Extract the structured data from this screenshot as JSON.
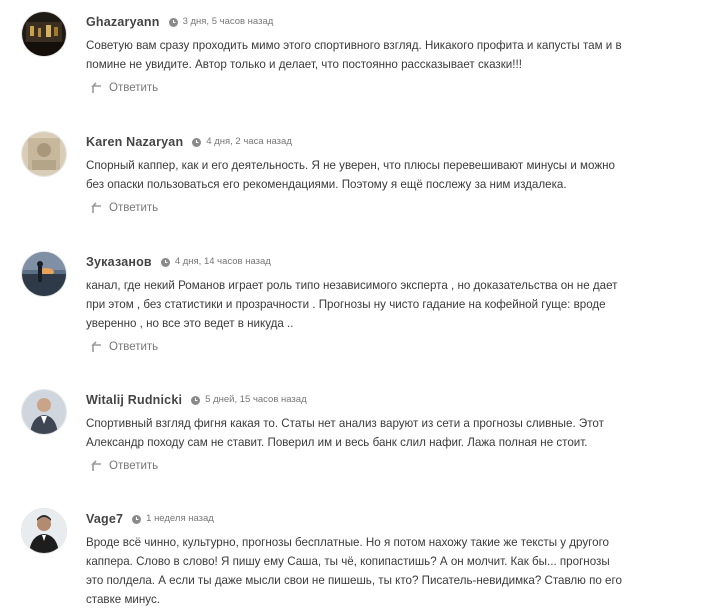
{
  "reply_label": "Ответить",
  "comments": [
    {
      "author": "Ghazaryann",
      "time": "3 дня, 5 часов назад",
      "text": "Советую вам сразу проходить мимо этого спортивного взгляд. Никакого профита и капусты там и в помине не увидите. Автор только и делает, что постоянно рассказывает сказки!!!",
      "avatar": "dark-photo"
    },
    {
      "author": "Karen Nazaryan",
      "time": "4 дня, 2 часа назад",
      "text": "Спорный каппер, как и его деятельность. Я не уверен, что плюсы перевешивают минусы и можно без опаски пользоваться его рекомендациями. Поэтому я ещё послежу за ним издалека.",
      "avatar": "beige-photo"
    },
    {
      "author": "Зуказанов",
      "time": "4 дня, 14 часов назад",
      "text": "канал, где некий Романов играет роль типо независимого эксперта , но доказательства он не дает при этом , без статистики и прозрачности . Прогнозы ну чисто гадание на кофейной гуще: вроде уверенно , но все это ведет в никуда ..",
      "avatar": "sunset-photo"
    },
    {
      "author": "Witalij Rudnicki",
      "time": "5 дней, 15 часов назад",
      "text": "Спортивный взгляд фигня какая то. Статы нет анализ варуют из сети а прогнозы сливные. Этот Александр походу сам не ставит. Поверил им и весь банк слил нафиг. Лажа полная не стоит.",
      "avatar": "man-suit-photo"
    },
    {
      "author": "Vage7",
      "time": "1 неделя назад",
      "text": "Вроде всё чинно, культурно, прогнозы бесплатные. Но я потом нахожу такие же тексты у другого каппера. Слово в слово! Я пишу ему Саша, ты чё, копипастишь? А он молчит. Как бы... прогнозы это полдела. А если ты даже мысли свои не пишешь, ты кто? Писатель-невидимка? Ставлю по его ставке минус.",
      "avatar": "man-dark-photo"
    }
  ]
}
